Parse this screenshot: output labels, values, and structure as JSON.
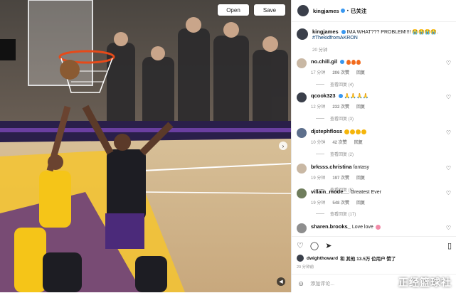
{
  "video": {
    "open_label": "Open",
    "save_label": "Save",
    "next_arrow": "chevron-right-icon",
    "mute_icon": "mute-icon"
  },
  "post": {
    "author": "kingjames",
    "follow_label": "已关注",
    "caption_user": "kingjames",
    "caption_text": "IMA WHAT??? PROBLEM!!!! 😭😭😭😭.",
    "hashtag": "#ThekidfromAKRON",
    "caption_time": "20 分钟"
  },
  "comments": [
    {
      "user": "no.chill.gil",
      "verified": true,
      "text": "",
      "emoji": "fire3",
      "time": "17 分钟",
      "likes": "206 次赞",
      "reply": "回复",
      "replies": "查看回复 (4)"
    },
    {
      "user": "qcook323",
      "verified": true,
      "text": "",
      "emoji": "hands4",
      "time": "12 分钟",
      "likes": "232 次赞",
      "reply": "回复",
      "replies": "查看回复 (3)"
    },
    {
      "user": "djstephfloss",
      "verified": false,
      "text": "",
      "emoji": "face4",
      "time": "10 分钟",
      "likes": "42 次赞",
      "reply": "回复",
      "replies": "查看回复 (2)"
    },
    {
      "user": "brksss.christina",
      "verified": false,
      "text": "fantasy",
      "emoji": "",
      "time": "19 分钟",
      "likes": "197 次赞",
      "reply": "回复",
      "replies": "查看回复 (5)"
    },
    {
      "user": "villain_mode__",
      "verified": false,
      "text": "Greatest Ever",
      "emoji": "",
      "time": "19 分钟",
      "likes": "548 次赞",
      "reply": "回复",
      "replies": "查看回复 (17)"
    },
    {
      "user": "sharen.brooks_",
      "verified": false,
      "text": "Love love",
      "emoji": "love",
      "time": "",
      "likes": "",
      "reply": "",
      "replies": ""
    }
  ],
  "likes_line": {
    "user": "dwighthoward",
    "rest": "和 其他 13.5万 位用户 赞了"
  },
  "post_time": "20 分钟前",
  "add_comment_placeholder": "添加评论...",
  "watermark": "正经篮球社",
  "colors": {
    "link": "#00376b",
    "verified": "#3897f0",
    "muted": "#8e8e8e"
  }
}
